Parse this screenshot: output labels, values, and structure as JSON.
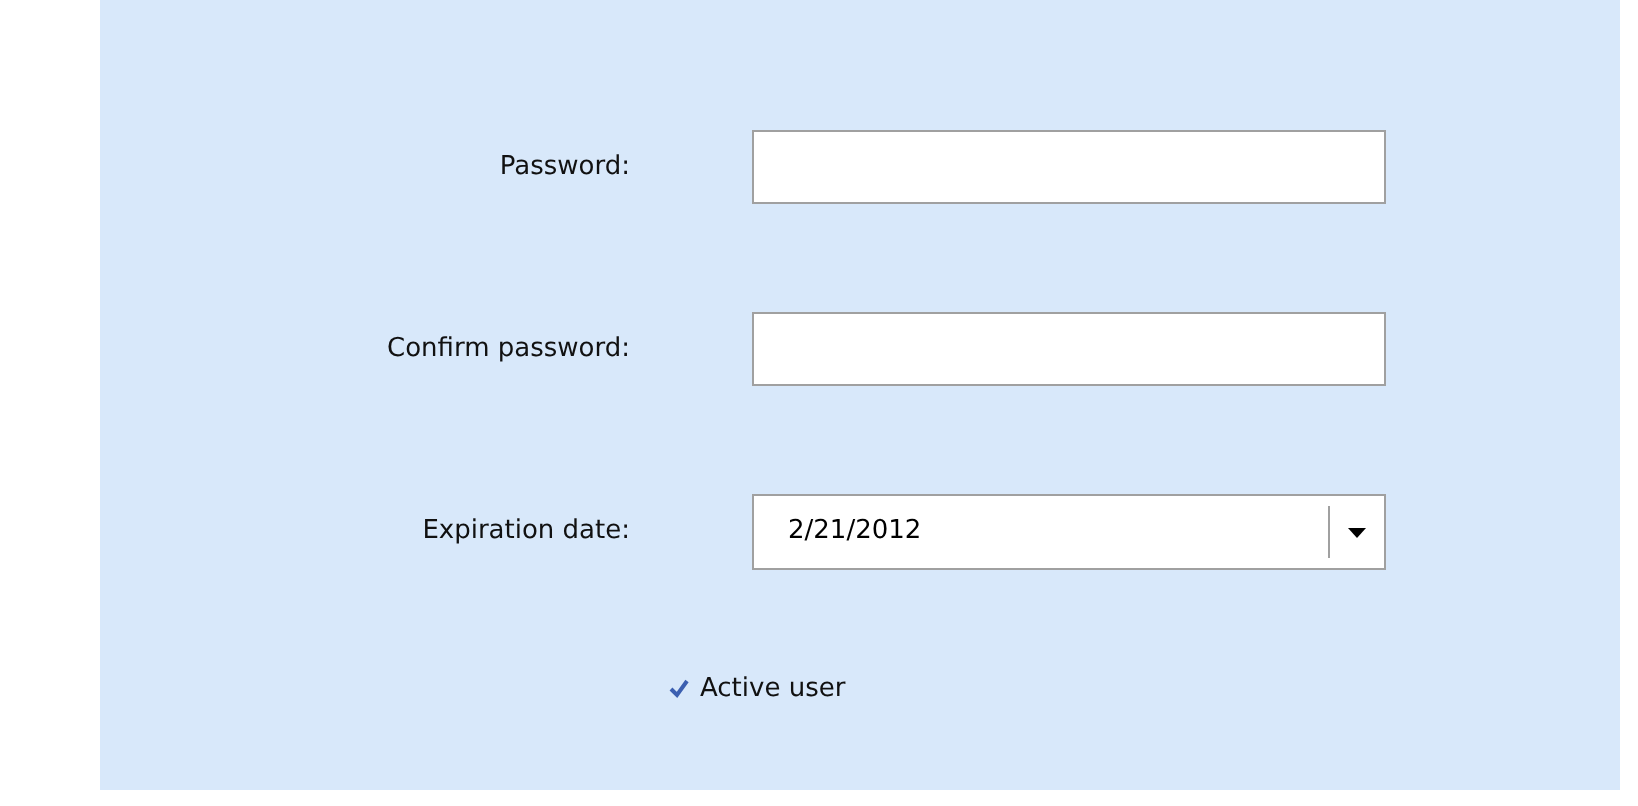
{
  "fields": [
    {
      "label": "Password:",
      "kind": "password"
    },
    {
      "label": "Confirm password:",
      "kind": "password"
    },
    {
      "label": "Expiration date:",
      "kind": "date",
      "value": "2/21/2012"
    }
  ],
  "active_user": {
    "label": "Active user",
    "checked": true
  }
}
